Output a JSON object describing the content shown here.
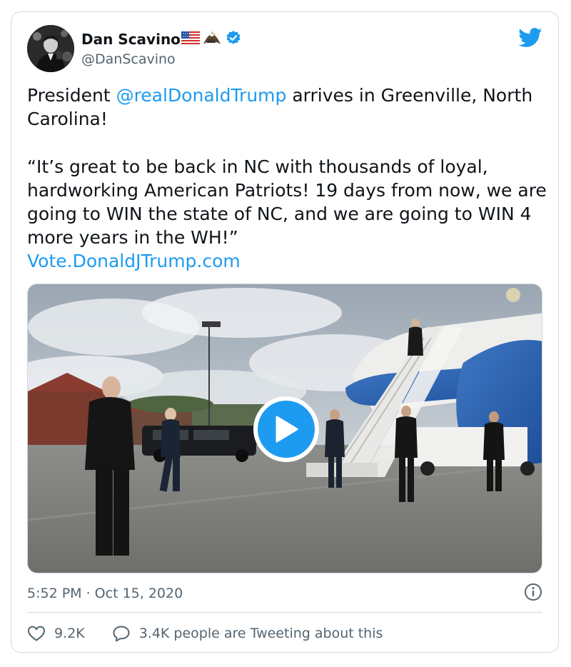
{
  "author": {
    "name": "Dan Scavino",
    "handle": "@DanScavino",
    "name_emojis": [
      "us-flag-emoji",
      "eagle-emoji"
    ],
    "verified": true
  },
  "tweet": {
    "line1_prefix": "President ",
    "mention": "@realDonaldTrump",
    "line1_suffix": " arrives in Greenville, North Carolina!",
    "quote": "“It’s great to be back in NC with thousands of loyal, hardworking American Patriots! 19 days from now, we are going to WIN the state of NC, and we are going to WIN 4 more years in the WH!”",
    "url": "Vote.DonaldJTrump.com"
  },
  "media": {
    "type": "video",
    "play_icon": "play-icon"
  },
  "meta": {
    "timestamp": "5:52 PM · Oct 15, 2020",
    "info_icon": "info-icon"
  },
  "stats": {
    "likes": "9.2K",
    "replies_text": "3.4K people are Tweeting about this"
  },
  "colors": {
    "accent": "#1d9bf0",
    "text": "#0f1419",
    "secondary": "#536471",
    "border": "#cfd9de"
  }
}
